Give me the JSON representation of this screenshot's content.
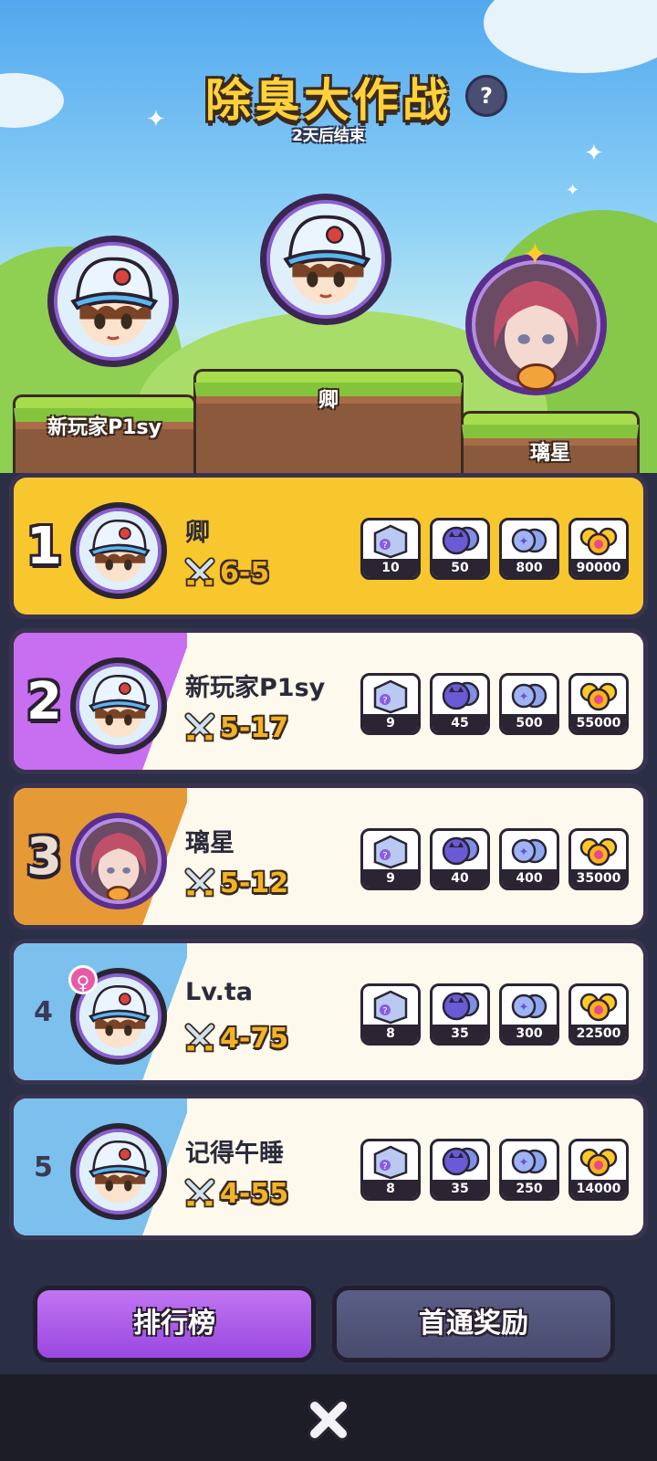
{
  "header": {
    "title": "除臭大作战",
    "subtitle": "2天后结束",
    "help_label": "?"
  },
  "podium": {
    "first": "卿",
    "second": "新玩家P1sy",
    "third": "璃星"
  },
  "ranking": [
    {
      "rank": "1",
      "name": "卿",
      "score": "6-5",
      "rewards": [
        "10",
        "50",
        "800",
        "90000"
      ]
    },
    {
      "rank": "2",
      "name": "新玩家P1sy",
      "score": "5-17",
      "rewards": [
        "9",
        "45",
        "500",
        "55000"
      ]
    },
    {
      "rank": "3",
      "name": "璃星",
      "score": "5-12",
      "rewards": [
        "9",
        "40",
        "400",
        "35000"
      ]
    },
    {
      "rank": "4",
      "name": "Lv.ta",
      "score": "4-75",
      "rewards": [
        "8",
        "35",
        "300",
        "22500"
      ]
    },
    {
      "rank": "5",
      "name": "记得午睡",
      "score": "4-55",
      "rewards": [
        "8",
        "35",
        "250",
        "14000"
      ]
    }
  ],
  "reward_icons": [
    "mystery-box-icon",
    "cat-capsule-icon",
    "orb-icon",
    "gold-coins-icon"
  ],
  "tabs": {
    "leaderboard": "排行榜",
    "first_clear": "首通奖励"
  },
  "gender_symbol": "♀",
  "colors": {
    "first_row": "#f8c62d",
    "second_accent": "#c86ef0",
    "third_accent": "#e59a36",
    "other_accent": "#7cc0ee",
    "tab_active": "#b062ec",
    "tab_inactive": "#52567a"
  }
}
